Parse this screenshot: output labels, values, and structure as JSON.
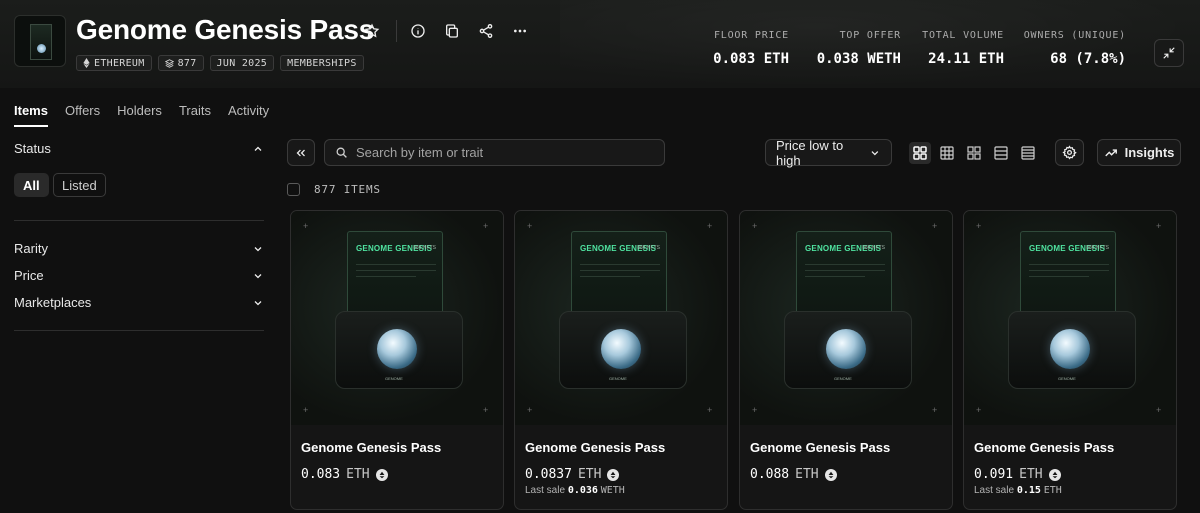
{
  "collection": {
    "title": "Genome Genesis Pass",
    "tags": [
      "ETHEREUM",
      "877",
      "JUN 2025",
      "MEMBERSHIPS"
    ]
  },
  "stats": [
    {
      "label": "FLOOR PRICE",
      "value": "0.083 ETH"
    },
    {
      "label": "TOP OFFER",
      "value": "0.038 WETH"
    },
    {
      "label": "TOTAL VOLUME",
      "value": "24.11 ETH"
    },
    {
      "label": "OWNERS (UNIQUE)",
      "value": "68 (7.8%)"
    }
  ],
  "tabs": [
    "Items",
    "Offers",
    "Holders",
    "Traits",
    "Activity"
  ],
  "sidebar": {
    "status_label": "Status",
    "status_options": [
      "All",
      "Listed"
    ],
    "filters": [
      "Rarity",
      "Price",
      "Marketplaces"
    ]
  },
  "toolbar": {
    "search_placeholder": "Search by item or trait",
    "sort_label": "Price low to high",
    "insights_label": "Insights",
    "items_count": "877 ITEMS"
  },
  "card_art": {
    "title_a": "GENOME",
    "title_b": "GENESIS",
    "count": "888 NFTS",
    "foot": "GENOME"
  },
  "items": [
    {
      "name": "Genome Genesis Pass",
      "price": "0.083",
      "currency": "ETH",
      "last_sale_label": "",
      "last_sale_value": "",
      "last_sale_currency": ""
    },
    {
      "name": "Genome Genesis Pass",
      "price": "0.0837",
      "currency": "ETH",
      "last_sale_label": "Last sale",
      "last_sale_value": "0.036",
      "last_sale_currency": "WETH"
    },
    {
      "name": "Genome Genesis Pass",
      "price": "0.088",
      "currency": "ETH",
      "last_sale_label": "",
      "last_sale_value": "",
      "last_sale_currency": ""
    },
    {
      "name": "Genome Genesis Pass",
      "price": "0.091",
      "currency": "ETH",
      "last_sale_label": "Last sale",
      "last_sale_value": "0.15",
      "last_sale_currency": "ETH"
    }
  ],
  "colors": {
    "background": "#101010",
    "border": "#3a3a3a",
    "accent": "#4fe3a0"
  }
}
